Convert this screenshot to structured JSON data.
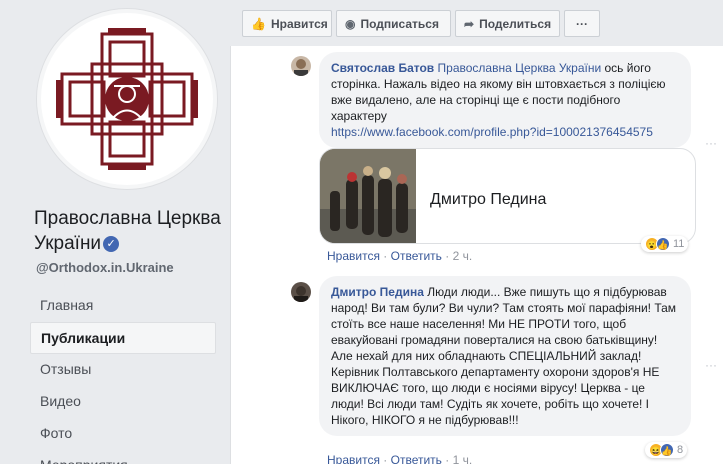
{
  "sidebar": {
    "page_name": "Православна Церква України",
    "handle": "@Orthodox.in.Ukraine",
    "nav": [
      {
        "label": "Главная"
      },
      {
        "label": "Публикации"
      },
      {
        "label": "Отзывы"
      },
      {
        "label": "Видео"
      },
      {
        "label": "Фото"
      },
      {
        "label": "Мероприятия"
      }
    ],
    "active_nav": "Публикации"
  },
  "actions": {
    "like": "Нравится",
    "subscribe": "Подписаться",
    "share": "Поделиться",
    "more": "···"
  },
  "comments": [
    {
      "author": "Святослав Батов",
      "mention": "Православна Церква України",
      "text": " ось його сторінка. Нажаль відео на якому він штовхається з поліцією вже видалено, але на сторінці ще є пости подібного характеру",
      "link": "https://www.facebook.com/profile.php?id=100021376454575",
      "preview_title": "Дмитро Педина",
      "reaction_count": "11",
      "like_label": "Нравится",
      "reply_label": "Ответить",
      "time": "2 ч."
    },
    {
      "author": "Дмитро Педина",
      "text": " Люди люди... Вже пишуть що я підбурював народ! Ви там були? Ви чули? Там стоять мої парафіяни! Там стоїть все наше населення! Ми НЕ ПРОТИ того, щоб евакуйовані громадяни поверталися на свою батьківщину! Але нехай для них обладнають СПЕЦІАЛЬНИЙ заклад! Керівник Полтавського департаменту охорони здоров'я НЕ ВИКЛЮЧАЄ того, що люди є носіями вірусу! Церква - це люди! Всі люди там! Судіть як хочете, робіть що хочете! І Нікого, НІКОГО я не підбурював!!!",
      "reaction_count": "8",
      "like_label": "Нравится",
      "reply_label": "Ответить",
      "time": "1 ч."
    }
  ],
  "colors": {
    "link": "#385898",
    "accent": "#4267b2",
    "emblem": "#7a1a22"
  }
}
